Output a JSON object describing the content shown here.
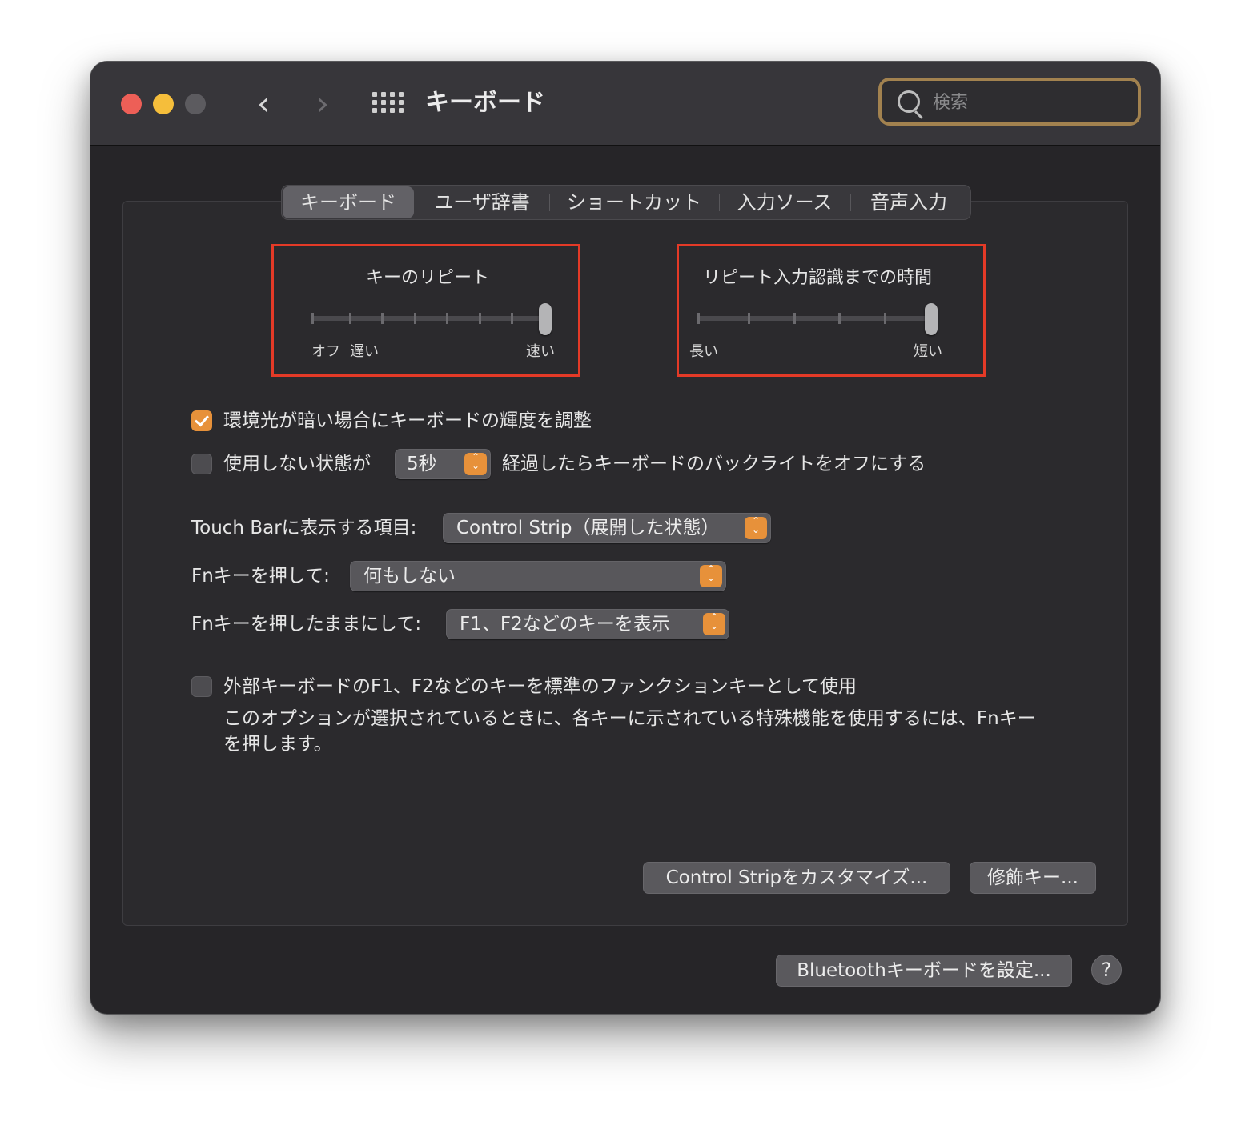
{
  "window": {
    "title": "キーボード",
    "search_placeholder": "検索"
  },
  "tabs": [
    "キーボード",
    "ユーザ辞書",
    "ショートカット",
    "入力ソース",
    "音声入力"
  ],
  "active_tab": "キーボード",
  "key_repeat": {
    "label": "キーのリピート",
    "label_off": "オフ",
    "label_slow": "遅い",
    "label_fast": "速い",
    "value": 1.0
  },
  "repeat_delay": {
    "label": "リピート入力認識までの時間",
    "label_long": "長い",
    "label_short": "短い",
    "value": 1.0
  },
  "ambient_light": {
    "label": "環境光が暗い場合にキーボードの輝度を調整",
    "checked": true
  },
  "backlight_off": {
    "label_before": "使用しない状態が",
    "duration": "5秒",
    "label_after": "経過したらキーボードのバックライトをオフにする",
    "checked": false
  },
  "touch_bar": {
    "label": "Touch Barに表示する項目:",
    "value": "Control Strip（展開した状態）"
  },
  "fn_press": {
    "label": "Fnキーを押して:",
    "value": "何もしない"
  },
  "fn_hold": {
    "label": "Fnキーを押したままにして:",
    "value": "F1、F2などのキーを表示"
  },
  "function_keys": {
    "label": "外部キーボードのF1、F2などのキーを標準のファンクションキーとして使用",
    "description_line1": "このオプションが選択されているときに、各キーに示されている特殊機能を使用するには、Fnキー",
    "description_line2": "を押します。",
    "checked": false
  },
  "buttons": {
    "customize": "Control Stripをカスタマイズ...",
    "modifier": "修飾キー...",
    "bluetooth": "Bluetoothキーボードを設定...",
    "help": "?"
  },
  "colors": {
    "accent": "#e7913a",
    "highlight_box": "#e43a27",
    "window_bg": "#262528"
  }
}
